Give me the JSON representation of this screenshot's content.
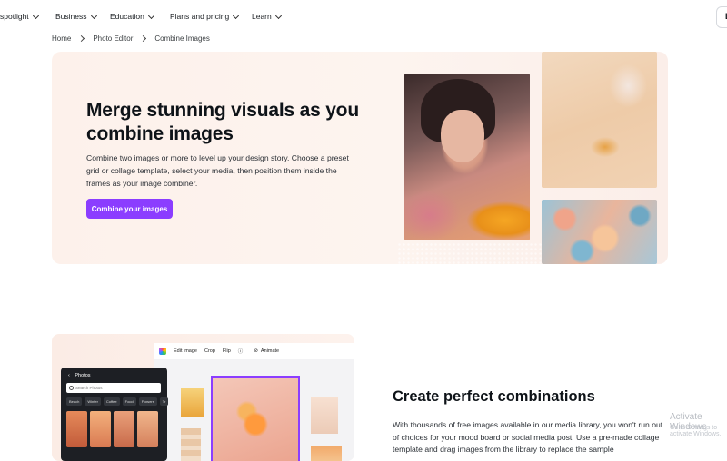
{
  "nav": {
    "items": [
      {
        "label": "spotlight"
      },
      {
        "label": "Business"
      },
      {
        "label": "Education"
      },
      {
        "label": "Plans and pricing"
      },
      {
        "label": "Learn"
      }
    ],
    "right_button_glyph": "L"
  },
  "breadcrumb": {
    "items": [
      "Home",
      "Photo Editor",
      "Combine Images"
    ]
  },
  "hero": {
    "title": "Merge stunning visuals as you combine images",
    "description": "Combine two images or more to level up your design story. Choose a preset grid or collage template, select your media, then position them inside the frames as your image combiner.",
    "button_label": "Combine your images",
    "accent_color": "#8b3dff"
  },
  "editor": {
    "toolbar": [
      "Edit image",
      "Crop",
      "Flip",
      "Animate"
    ],
    "info_glyph": "ⓘ",
    "animate_glyph": "⊘",
    "panel_title": "Photos",
    "back_glyph": "‹",
    "search_placeholder": "Search Photos",
    "chips": [
      "Beach",
      "Winter",
      "Coffee",
      "Food",
      "Flowers",
      "Tr"
    ]
  },
  "section": {
    "title": "Create perfect combinations",
    "description": "With thousands of free images available in our media library, you won't run out of choices for your mood board or social media post. Use a pre-made collage template and drag images from the library to replace the sample"
  },
  "watermark": {
    "line1": "Activate Windows",
    "line2": "Go to Settings to activate Windows."
  }
}
